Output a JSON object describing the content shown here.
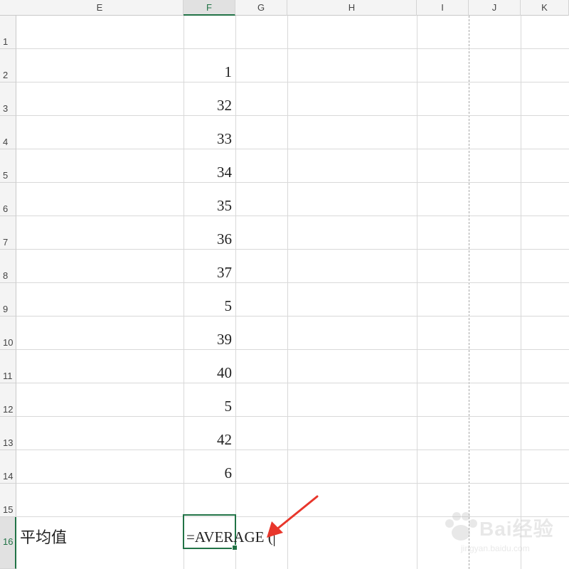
{
  "columns": [
    "E",
    "F",
    "G",
    "H",
    "I",
    "J",
    "K"
  ],
  "selected_column": "F",
  "rows": [
    "1",
    "2",
    "3",
    "4",
    "5",
    "6",
    "7",
    "8",
    "9",
    "10",
    "11",
    "12",
    "13",
    "14",
    "15",
    "16"
  ],
  "selected_row": "16",
  "f_values": [
    "",
    "1",
    "32",
    "33",
    "34",
    "35",
    "36",
    "37",
    "5",
    "39",
    "40",
    "5",
    "42",
    "6",
    "",
    ""
  ],
  "label_cell": "平均值",
  "formula_text": "=AVERAGE (",
  "annotation": {
    "arrow_color": "#e8362b"
  },
  "accent_color": "#217346",
  "watermark": {
    "brand": "Bai经验",
    "url": "jingyan.baidu.com"
  }
}
